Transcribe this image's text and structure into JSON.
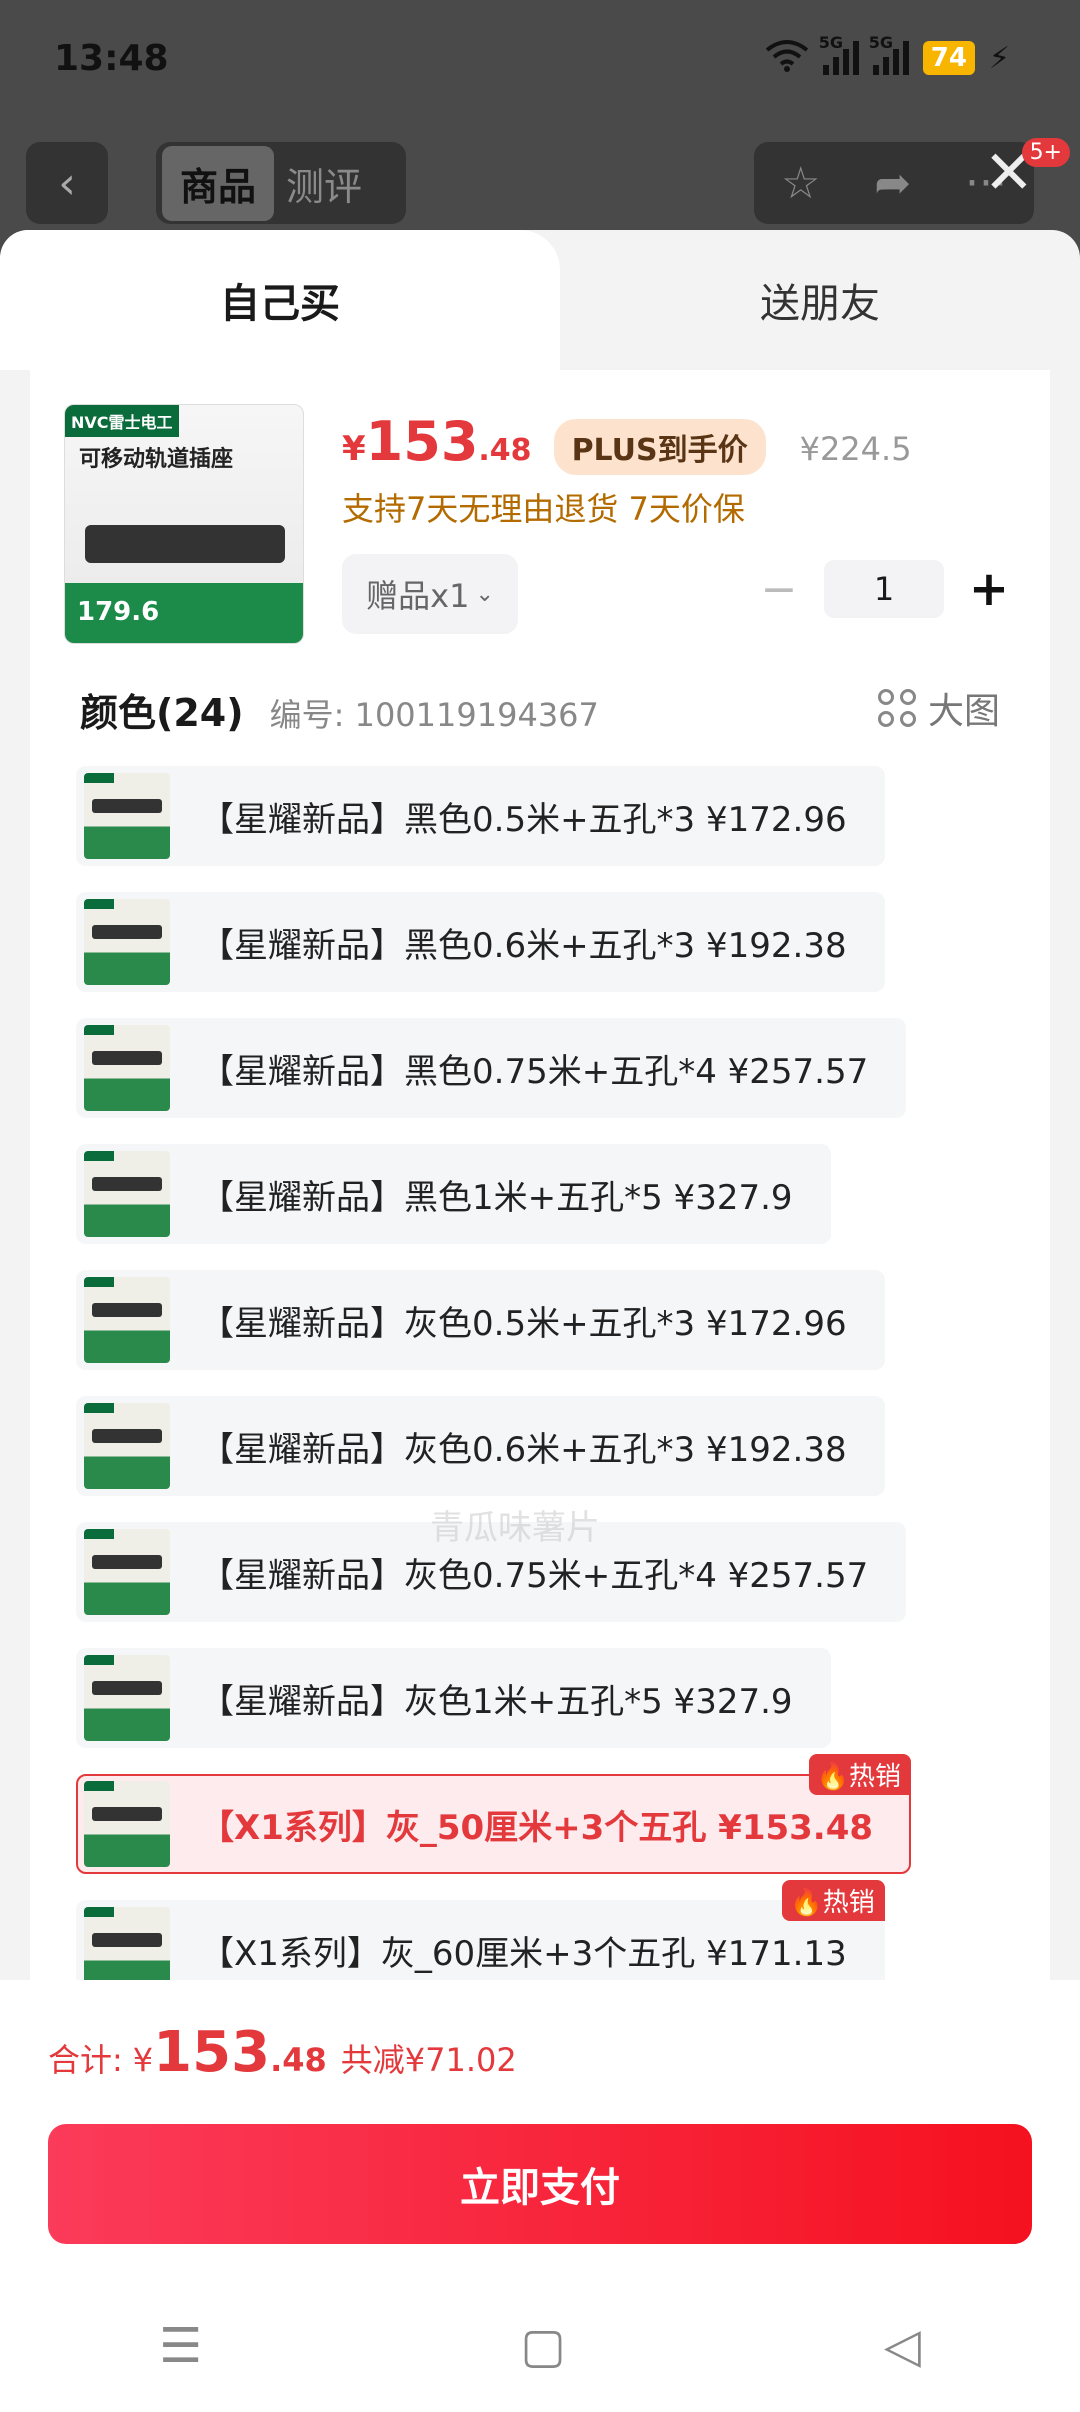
{
  "status_bar": {
    "time": "13:48",
    "net1": "5G",
    "net2": "5G",
    "battery": "74"
  },
  "background_header": {
    "tab_goods": "商品",
    "tab_review": "测评",
    "badge": "5+"
  },
  "sheet_tabs": {
    "self": "自己买",
    "friend": "送朋友"
  },
  "product": {
    "thumbnail": {
      "brand": "NVC雷士电工",
      "title": "可移动轨道插座",
      "promo_price": "179.6"
    },
    "price": {
      "currency": "¥",
      "integer": "153",
      "decimal": ".48"
    },
    "plus_tag": "PLUS到手价",
    "original_price": "¥224.5",
    "guarantee": "支持7天无理由退货  7天价保",
    "gift": "赠品x1",
    "quantity": "1"
  },
  "color_section": {
    "label": "颜色(24)",
    "sku": "编号: 100119194367",
    "big_image": "大图"
  },
  "options": [
    {
      "text": "【星耀新品】黑色0.5米+五孔*3  ¥172.96",
      "selected": false,
      "hot": ""
    },
    {
      "text": "【星耀新品】黑色0.6米+五孔*3  ¥192.38",
      "selected": false,
      "hot": ""
    },
    {
      "text": "【星耀新品】黑色0.75米+五孔*4  ¥257.57",
      "selected": false,
      "hot": ""
    },
    {
      "text": "【星耀新品】黑色1米+五孔*5  ¥327.9",
      "selected": false,
      "hot": ""
    },
    {
      "text": "【星耀新品】灰色0.5米+五孔*3  ¥172.96",
      "selected": false,
      "hot": ""
    },
    {
      "text": "【星耀新品】灰色0.6米+五孔*3  ¥192.38",
      "selected": false,
      "hot": ""
    },
    {
      "text": "【星耀新品】灰色0.75米+五孔*4  ¥257.57",
      "selected": false,
      "hot": ""
    },
    {
      "text": "【星耀新品】灰色1米+五孔*5  ¥327.9",
      "selected": false,
      "hot": ""
    },
    {
      "text": "【X1系列】灰_50厘米+3个五孔  ¥153.48",
      "selected": true,
      "hot": "热销"
    },
    {
      "text": "【X1系列】灰_60厘米+3个五孔  ¥171.13",
      "selected": false,
      "hot": "热销"
    }
  ],
  "watermark": "青瓜味薯片",
  "footer": {
    "total_label": "合计:",
    "currency": "¥",
    "total_integer": "153",
    "total_decimal": ".48",
    "savings": "共减¥71.02",
    "pay_button": "立即支付"
  },
  "colors": {
    "accent": "#e4393c",
    "guarantee": "#b36b00",
    "plus_bg": "#fde3cd"
  }
}
